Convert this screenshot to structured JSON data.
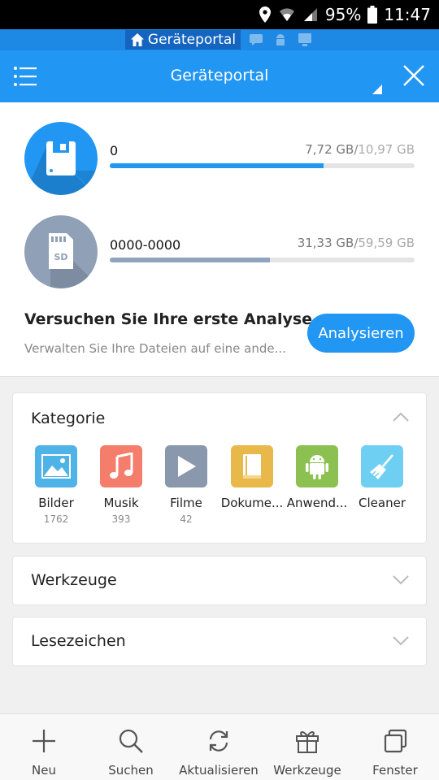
{
  "status_bar": {
    "battery": "95%",
    "time": "11:47"
  },
  "tab_strip": {
    "active_tab": "Geräteportal"
  },
  "header": {
    "title": "Geräteportal"
  },
  "storage": [
    {
      "name": "0",
      "used": "7,72 GB",
      "total": "10,97 GB",
      "fill_fraction": 0.7,
      "color": "#2196f3",
      "icon": "floppy-icon"
    },
    {
      "name": "0000-0000",
      "used": "31,33 GB",
      "total": "59,59 GB",
      "fill_fraction": 0.526,
      "color": "#90a4be",
      "icon": "sd-card-icon"
    }
  ],
  "analyse": {
    "title": "Versuchen Sie Ihre erste Analyse",
    "subtitle": "Verwalten Sie Ihre Dateien auf eine ande...",
    "button": "Analysieren"
  },
  "category": {
    "title": "Kategorie",
    "items": [
      {
        "label": "Bilder",
        "count": "1762",
        "color": "#4fb3e8",
        "icon": "image-icon"
      },
      {
        "label": "Musik",
        "count": "393",
        "color": "#f47d6b",
        "icon": "music-icon"
      },
      {
        "label": "Filme",
        "count": "42",
        "color": "#8a98ad",
        "icon": "play-icon"
      },
      {
        "label": "Dokume...",
        "count": "",
        "color": "#e8b84a",
        "icon": "book-icon"
      },
      {
        "label": "Anwend...",
        "count": "",
        "color": "#8cc152",
        "icon": "android-icon"
      },
      {
        "label": "Cleaner",
        "count": "",
        "color": "#6fcff3",
        "icon": "broom-icon"
      }
    ]
  },
  "tools": {
    "title": "Werkzeuge"
  },
  "bookmarks": {
    "title": "Lesezeichen"
  },
  "bottom_nav": [
    {
      "label": "Neu",
      "icon": "plus-icon"
    },
    {
      "label": "Suchen",
      "icon": "search-icon"
    },
    {
      "label": "Aktualisieren",
      "icon": "refresh-icon"
    },
    {
      "label": "Werkzeuge",
      "icon": "gift-icon"
    },
    {
      "label": "Fenster",
      "icon": "windows-icon"
    }
  ]
}
